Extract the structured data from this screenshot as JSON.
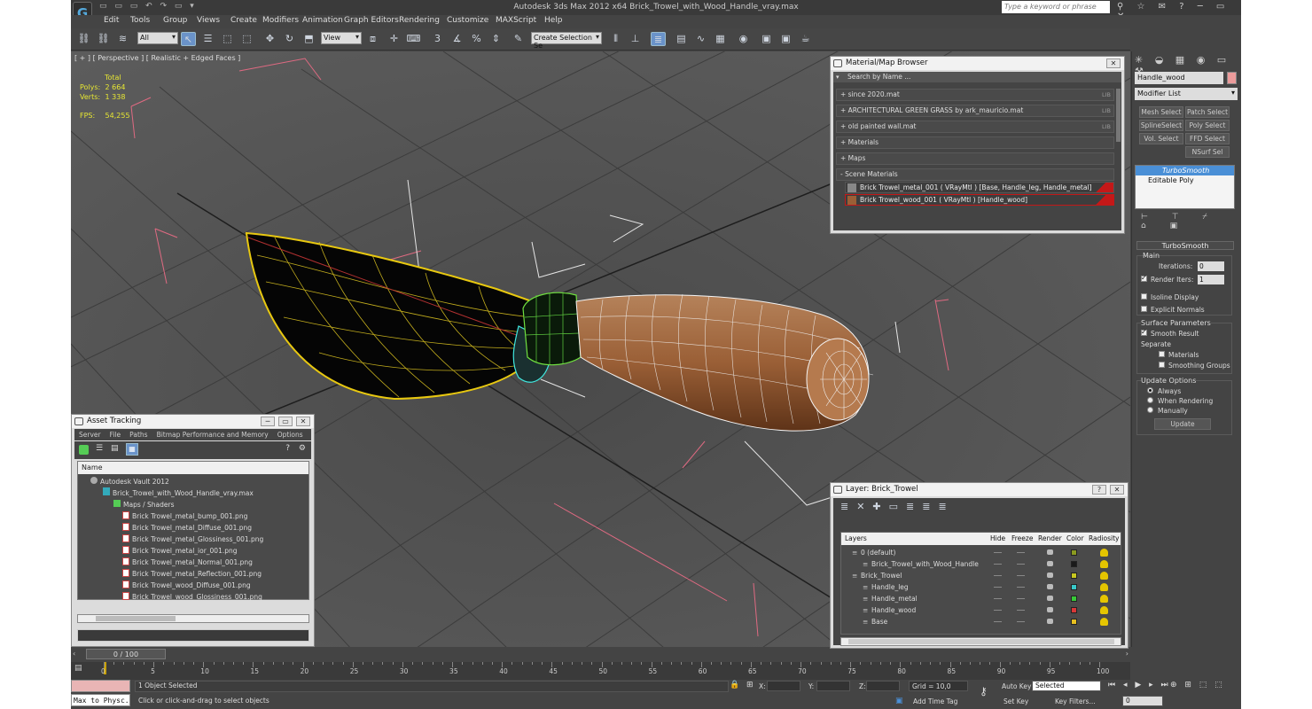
{
  "titlebar": {
    "logo": "G",
    "title": "Autodesk 3ds Max  2012 x64     Brick_Trowel_with_Wood_Handle_vray.max",
    "search_placeholder": "Type a keyword or phrase"
  },
  "menu": [
    "Edit",
    "Tools",
    "Group",
    "Views",
    "Create",
    "Modifiers",
    "Animation",
    "Graph Editors",
    "Rendering",
    "Customize",
    "MAXScript",
    "Help"
  ],
  "toolbar": {
    "filter_value": "All",
    "refcoord_value": "View",
    "selection_set_placeholder": "Create Selection Se"
  },
  "viewport": {
    "label": "[ + ] [ Perspective ] [ Realistic + Edged Faces ]",
    "stats_total": "Total",
    "polys_label": "Polys:",
    "polys_value": "2 664",
    "verts_label": "Verts:",
    "verts_value": "1 338",
    "fps_label": "FPS:",
    "fps_value": "54,255"
  },
  "command_panel": {
    "object_name": "Handle_wood",
    "object_color": "#ec9b9b",
    "modifier_list": "Modifier List",
    "buttons": [
      "Mesh Select",
      "Patch Select",
      "SplineSelect",
      "Poly Select",
      "Vol. Select",
      "FFD Select",
      "NSurf Sel"
    ],
    "stack": [
      "TurboSmooth",
      "Editable Poly"
    ],
    "turbosmooth": {
      "title": "TurboSmooth",
      "main": "Main",
      "iterations_label": "Iterations:",
      "iterations_value": "0",
      "render_iters_label": "Render Iters:",
      "render_iters_value": "1",
      "isoline": "Isoline Display",
      "explicit_normals": "Explicit Normals",
      "surface_params": "Surface Parameters",
      "smooth_result": "Smooth Result",
      "separate": "Separate",
      "materials": "Materials",
      "smoothing_groups": "Smoothing Groups",
      "update_options": "Update Options",
      "always": "Always",
      "when_rendering": "When Rendering",
      "manually": "Manually",
      "update_button": "Update"
    }
  },
  "material_browser": {
    "title": "Material/Map Browser",
    "search_placeholder": "Search by Name ...",
    "libraries": [
      {
        "label": "+ since 2020.mat",
        "tag": "LIB"
      },
      {
        "label": "+ ARCHITECTURAL GREEN GRASS by ark_mauricio.mat",
        "tag": "LIB"
      },
      {
        "label": "+ old painted wall.mat",
        "tag": "LIB"
      },
      {
        "label": "+ Materials",
        "tag": ""
      },
      {
        "label": "+ Maps",
        "tag": ""
      },
      {
        "label": "- Scene Materials",
        "tag": ""
      }
    ],
    "scene_materials": [
      "Brick Trowel_metal_001  ( VRayMtl )  [Base, Handle_leg, Handle_metal]",
      "Brick Trowel_wood_001  ( VRayMtl )  [Handle_wood]"
    ]
  },
  "asset_tracking": {
    "title": "Asset Tracking",
    "menu": [
      "Server",
      "File",
      "Paths",
      "Bitmap Performance and Memory",
      "Options"
    ],
    "column_name": "Name",
    "tree": [
      "Autodesk Vault 2012",
      "Brick_Trowel_with_Wood_Handle_vray.max",
      "Maps / Shaders",
      "Brick Trowel_metal_bump_001.png",
      "Brick Trowel_metal_Diffuse_001.png",
      "Brick Trowel_metal_Glossiness_001.png",
      "Brick Trowel_metal_ior_001.png",
      "Brick Trowel_metal_Normal_001.png",
      "Brick Trowel_metal_Reflection_001.png",
      "Brick Trowel_wood_Diffuse_001.png",
      "Brick Trowel_wood_Glossiness_001.png"
    ]
  },
  "layer_panel": {
    "title": "Layer: Brick_Trowel",
    "columns": [
      "Layers",
      "Hide",
      "Freeze",
      "Render",
      "Color",
      "Radiosity"
    ],
    "rows": [
      {
        "name": "0 (default)",
        "color": "#8a9a20"
      },
      {
        "name": "Brick_Trowel_with_Wood_Handle",
        "color": "#1a1a1a"
      },
      {
        "name": "Brick_Trowel",
        "color": "#c8c820"
      },
      {
        "name": "Handle_leg",
        "color": "#38c8c8"
      },
      {
        "name": "Handle_metal",
        "color": "#38c838"
      },
      {
        "name": "Handle_wood",
        "color": "#d83838"
      },
      {
        "name": "Base",
        "color": "#e8c020"
      }
    ]
  },
  "timeline": {
    "frame_slider": "0 / 100",
    "ticks": [
      "0",
      "5",
      "10",
      "15",
      "20",
      "25",
      "30",
      "35",
      "40",
      "45",
      "50",
      "55",
      "60",
      "65",
      "70",
      "75",
      "80",
      "85",
      "90",
      "95",
      "100"
    ]
  },
  "status": {
    "maxscript": "Max to Physc.",
    "objects_selected": "1 Object Selected",
    "prompt": "Click or click-and-drag to select objects",
    "x_label": "X:",
    "y_label": "Y:",
    "z_label": "Z:",
    "grid": "Grid = 10,0",
    "add_time_tag": "Add Time Tag",
    "auto_key": "Auto Key",
    "selected": "Selected",
    "set_key": "Set Key",
    "key_filters": "Key Filters...",
    "frame_value": "0"
  }
}
